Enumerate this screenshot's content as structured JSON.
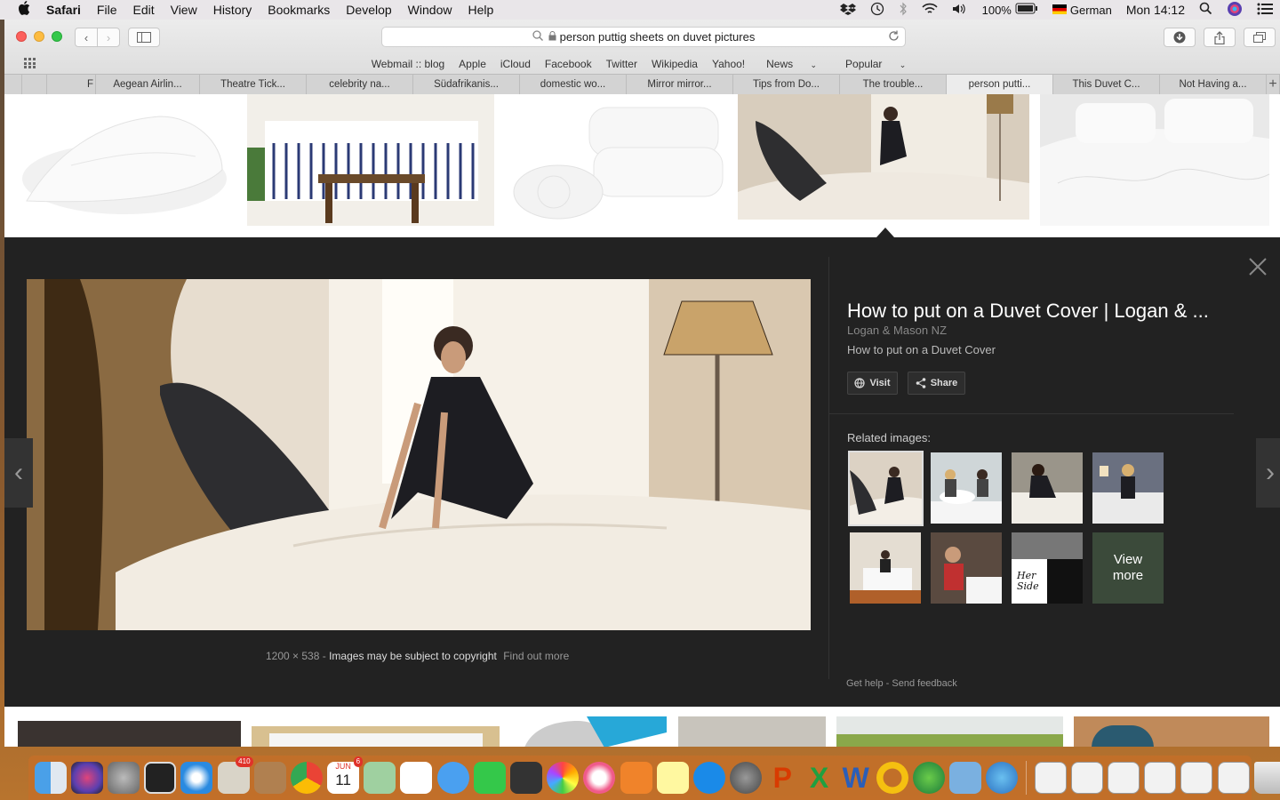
{
  "menubar": {
    "apple": "",
    "app": "Safari",
    "items": [
      "File",
      "Edit",
      "View",
      "History",
      "Bookmarks",
      "Develop",
      "Window",
      "Help"
    ],
    "battery": "100%",
    "input_lang": "German",
    "clock": "Mon 14:12"
  },
  "browser": {
    "url": "person puttig sheets on duvet pictures",
    "favorites": [
      "Webmail :: blog",
      "Apple",
      "iCloud",
      "Facebook",
      "Twitter",
      "Wikipedia",
      "Yahoo!",
      "News",
      "Popular"
    ],
    "tabs": [
      "",
      "",
      "F",
      "Aegean Airlin...",
      "Theatre Tick...",
      "celebrity na...",
      "Südafrikanis...",
      "domestic wo...",
      "Mirror mirror...",
      "Tips from Do...",
      "The trouble...",
      "person putti...",
      "This Duvet C...",
      "Not Having a..."
    ]
  },
  "preview": {
    "title": "How to put on a Duvet Cover | Logan & ...",
    "source": "Logan & Mason NZ",
    "description": "How to put on a Duvet Cover",
    "visit": "Visit",
    "share": "Share",
    "related_header": "Related images:",
    "view_more": "View more",
    "dimensions": "1200 × 538",
    "sep": "-",
    "copyright": "Images may be subject to copyright",
    "find_out": "Find out more",
    "get_help": "Get help",
    "send_feedback": "Send feedback"
  },
  "dock": {
    "badges": {
      "mail": "410",
      "calendar": "6"
    },
    "calendar_month": "JUN",
    "calendar_day": "11"
  }
}
